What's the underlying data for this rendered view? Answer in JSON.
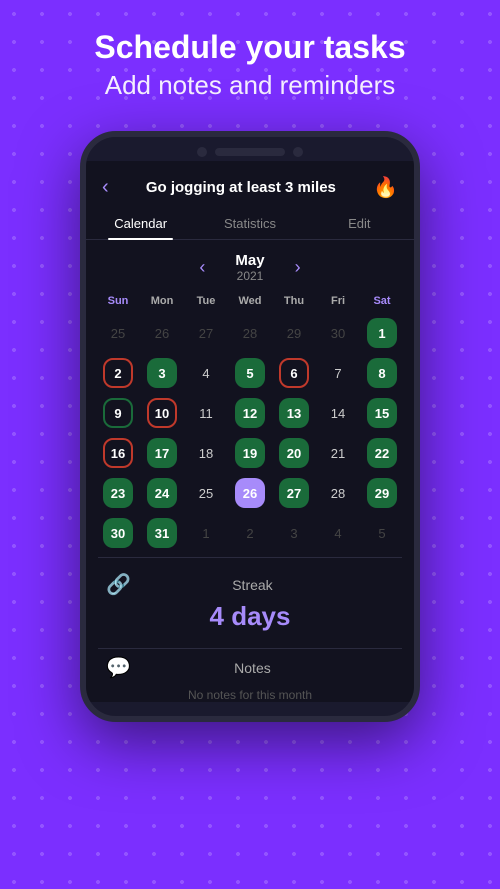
{
  "hero": {
    "title": "Schedule your tasks",
    "subtitle": "Add notes and reminders"
  },
  "app": {
    "header": {
      "title": "Go jogging at least 3 miles",
      "back_label": "‹",
      "flame_label": "🔥"
    },
    "tabs": [
      {
        "id": "calendar",
        "label": "Calendar",
        "active": true
      },
      {
        "id": "statistics",
        "label": "Statistics",
        "active": false
      },
      {
        "id": "edit",
        "label": "Edit",
        "active": false
      }
    ],
    "calendar": {
      "month": "May",
      "year": "2021",
      "prev_arrow": "‹",
      "next_arrow": "›",
      "day_headers": [
        {
          "label": "Sun",
          "class": "sun"
        },
        {
          "label": "Mon",
          "class": "weekday"
        },
        {
          "label": "Tue",
          "class": "weekday"
        },
        {
          "label": "Wed",
          "class": "weekday"
        },
        {
          "label": "Thu",
          "class": "weekday"
        },
        {
          "label": "Fri",
          "class": "weekday"
        },
        {
          "label": "Sat",
          "class": "sat"
        }
      ]
    },
    "streak": {
      "label": "Streak",
      "value": "4 days"
    },
    "notes": {
      "label": "Notes",
      "empty_message": "No notes for this month"
    }
  }
}
